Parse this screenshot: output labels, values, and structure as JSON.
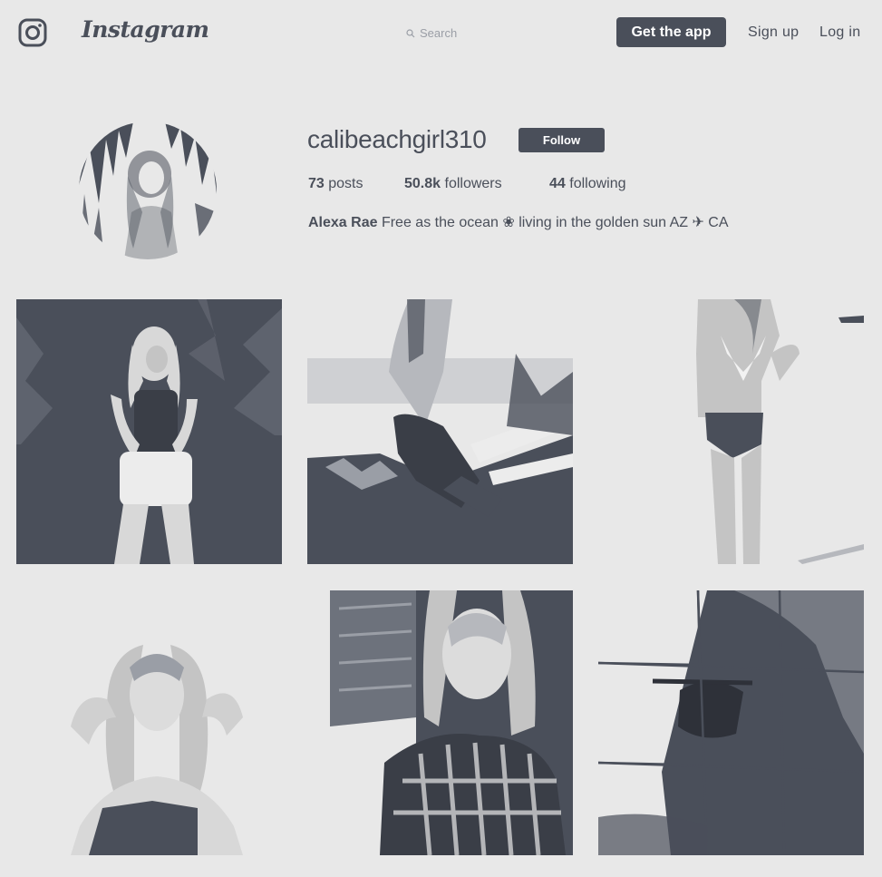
{
  "colors": {
    "dark": "#4a4f5a",
    "background": "#e8e8e8",
    "light": "#ffffff"
  },
  "header": {
    "wordmark": "Instagram",
    "search_placeholder": "Search",
    "get_app_label": "Get the app",
    "signup_label": "Sign up",
    "login_label": "Log in"
  },
  "profile": {
    "username": "calibeachgirl310",
    "follow_label": "Follow",
    "posts_count": "73",
    "posts_label": "posts",
    "followers_count": "50.8k",
    "followers_label": "followers",
    "following_count": "44",
    "following_label": "following",
    "full_name": "Alexa Rae",
    "bio": "Free as the ocean  ❀ living in the golden sun AZ ✈ CA"
  },
  "grid": {
    "photos": [
      "photo-1",
      "photo-2",
      "photo-3",
      "photo-4",
      "photo-5",
      "photo-6"
    ]
  }
}
